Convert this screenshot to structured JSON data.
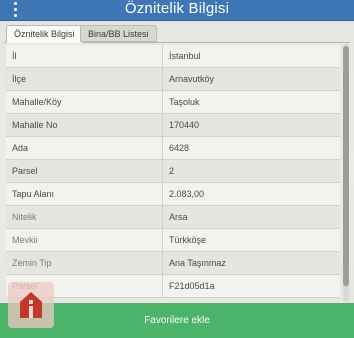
{
  "window": {
    "title": "Öznitelik Bilgisi"
  },
  "tabs": [
    {
      "label": "Öznitelik Bilgisi",
      "active": true
    },
    {
      "label": "Bina/BB Listesi",
      "active": false
    }
  ],
  "attributes": [
    {
      "key": "İl",
      "value": "İstanbul"
    },
    {
      "key": "İlçe",
      "value": "Arnavutköy"
    },
    {
      "key": "Mahalle/Köy",
      "value": "Taşoluk"
    },
    {
      "key": "Mahalle No",
      "value": "170440"
    },
    {
      "key": "Ada",
      "value": "6428"
    },
    {
      "key": "Parsel",
      "value": "2"
    },
    {
      "key": "Tapu Alanı",
      "value": "2.083,00"
    },
    {
      "key": "Nitelik",
      "value": "Arsa"
    },
    {
      "key": "Mevkii",
      "value": "Türkköşe"
    },
    {
      "key": "Zemin Tip",
      "value": "Ana Taşınmaz"
    },
    {
      "key": "Parsel",
      "value": "F21d05d1a"
    }
  ],
  "actions": {
    "favorite_label": "Favorilere ekle"
  },
  "icons": {
    "menu": "vertical-dots-icon",
    "home": "home-icon"
  },
  "colors": {
    "header": "#3f76b5",
    "favorite_button": "#4cb36b",
    "home_icon": "#c0392b"
  }
}
